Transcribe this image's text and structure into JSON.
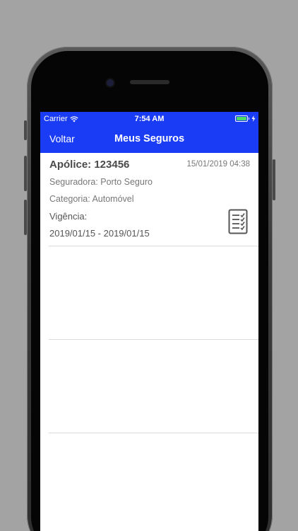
{
  "status_bar": {
    "carrier": "Carrier",
    "time": "7:54 AM",
    "wifi_icon": "wifi-icon",
    "battery_icon": "battery-icon",
    "battery_level": 1.0
  },
  "nav": {
    "back_label": "Voltar",
    "title": "Meus Seguros"
  },
  "policies": [
    {
      "title": "Apólice: 123456",
      "datetime": "15/01/2019 04:38",
      "insurer": "Seguradora: Porto Seguro",
      "category": "Categoria: Automóvel",
      "validity_label": "Vigência:",
      "validity_value": "2019/01/15 - 2019/01/15",
      "icon": "checklist-icon"
    }
  ],
  "colors": {
    "nav_background": "#1b3cf5",
    "nav_text": "#ffffff",
    "battery": "#4cd964",
    "separator": "#dcdcdc"
  }
}
